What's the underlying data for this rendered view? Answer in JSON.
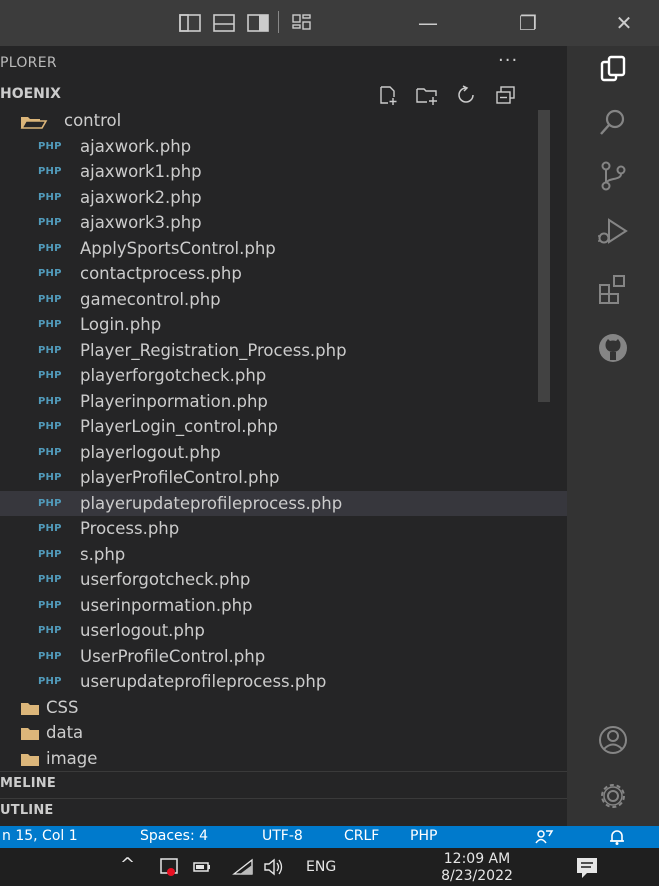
{
  "titlebar": {
    "layout_icons": [
      "layout-primary-sidebar-icon",
      "layout-panel-icon",
      "layout-secondary-sidebar-icon",
      "customize-layout-icon"
    ],
    "minimize_label": "—",
    "restore_label": "❐",
    "close_label": "✕"
  },
  "explorer": {
    "title": "PLORER",
    "more_label": "···",
    "project": "HOENIX",
    "toolbar_icons": [
      "new-file-icon",
      "new-folder-icon",
      "refresh-icon",
      "collapse-all-icon"
    ]
  },
  "tree": {
    "open_folder": "control",
    "php_badge": "PHP",
    "files": [
      "ajaxwork.php",
      "ajaxwork1.php",
      "ajaxwork2.php",
      "ajaxwork3.php",
      "ApplySportsControl.php",
      "contactprocess.php",
      "gamecontrol.php",
      "Login.php",
      "Player_Registration_Process.php",
      "playerforgotcheck.php",
      "Playerinpormation.php",
      "PlayerLogin_control.php",
      "playerlogout.php",
      "playerProfileControl.php",
      "playerupdateprofileprocess.php",
      "Process.php",
      "s.php",
      "userforgotcheck.php",
      "userinpormation.php",
      "userlogout.php",
      "UserProfileControl.php",
      "userupdateprofileprocess.php"
    ],
    "selected_index": 14,
    "folders": [
      "CSS",
      "data",
      "image"
    ]
  },
  "panels": {
    "timeline": "MELINE",
    "outline": "UTLINE"
  },
  "activity_bar": {
    "icons": [
      "explorer-icon",
      "search-icon",
      "source-control-icon",
      "run-debug-icon",
      "extensions-icon",
      "github-icon",
      "accounts-icon",
      "settings-gear-icon"
    ]
  },
  "status_bar": {
    "cursor": "n 15, Col 1",
    "spaces": "Spaces: 4",
    "encoding": "UTF-8",
    "eol": "CRLF",
    "language": "PHP"
  },
  "taskbar": {
    "chevron": "^",
    "language": "ENG",
    "time": "12:09 AM",
    "date": "8/23/2022"
  },
  "colors": {
    "sidebar_bg": "#252526",
    "activity_bg": "#333333",
    "status_bg": "#007acc",
    "php_badge": "#519aba",
    "selected_row": "#37373d"
  }
}
